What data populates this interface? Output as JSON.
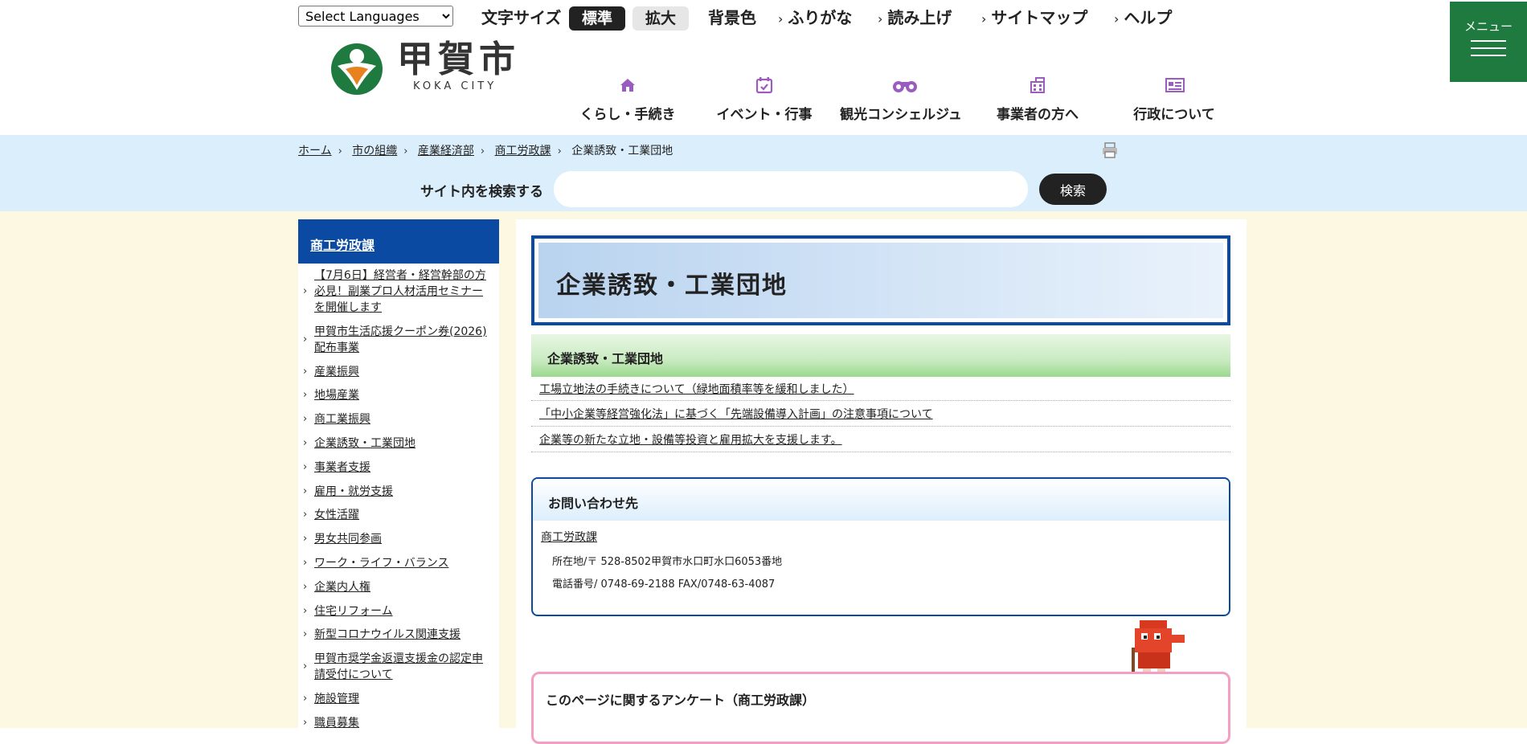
{
  "header": {
    "language_select": "Select Languages",
    "font_size_label": "文字サイズ",
    "font_size_standard": "標準",
    "font_size_large": "拡大",
    "bg_color_label": "背景色",
    "furigana": "ふりがな",
    "read_aloud": "読み上げ",
    "sitemap": "サイトマップ",
    "help": "ヘルプ",
    "logo_name": "甲賀市",
    "logo_sub": "KOKA CITY",
    "menu_label": "メニュー"
  },
  "nav": [
    {
      "label": "くらし・手続き",
      "icon": "house-icon"
    },
    {
      "label": "イベント・行事",
      "icon": "calendar-icon"
    },
    {
      "label": "観光コンシェルジュ",
      "icon": "binoculars-icon"
    },
    {
      "label": "事業者の方へ",
      "icon": "building-icon"
    },
    {
      "label": "行政について",
      "icon": "newspaper-icon"
    }
  ],
  "breadcrumb": {
    "items": [
      "ホーム",
      "市の組織",
      "産業経済部",
      "商工労政課"
    ],
    "current": "企業誘致・工業団地"
  },
  "search": {
    "label": "サイト内を検索する",
    "placeholder": "",
    "button": "検索"
  },
  "sidebar": {
    "heading": "商工労政課",
    "items": [
      "【7月6日】経営者・経営幹部の方必見！副業プロ人材活用セミナーを開催します",
      "甲賀市生活応援クーポン券(2026)配布事業",
      "産業振興",
      "地場産業",
      "商工業振興",
      "企業誘致・工業団地",
      "事業者支援",
      "雇用・就労支援",
      "女性活躍",
      "男女共同参画",
      "ワーク・ライフ・バランス",
      "企業内人権",
      "住宅リフォーム",
      "新型コロナウイルス関連支援",
      "甲賀市奨学金返還支援金の認定申請受付について",
      "施設管理",
      "職員募集"
    ]
  },
  "main": {
    "title": "企業誘致・工業団地",
    "section_title": "企業誘致・工業団地",
    "links": [
      "工場立地法の手続きについて（緑地面積率等を緩和しました）",
      "「中小企業等経営強化法」に基づく「先端設備導入計画」の注意事項について",
      "企業等の新たな立地・設備等投資と雇用拡大を支援します。"
    ]
  },
  "contact": {
    "heading": "お問い合わせ先",
    "department": "商工労政課",
    "address": "所在地/〒 528-8502甲賀市水口町水口6053番地",
    "tel": "電話番号/ 0748-69-2188 FAX/0748-63-4087"
  },
  "survey": {
    "title": "このページに関するアンケート（商工労政課）"
  },
  "colors": {
    "brand_blue": "#0a4aa3",
    "menu_green": "#1f7a3f",
    "band_blue": "#dbeefb",
    "cream": "#fdf8e1",
    "nav_icon": "#9a5cc0"
  }
}
